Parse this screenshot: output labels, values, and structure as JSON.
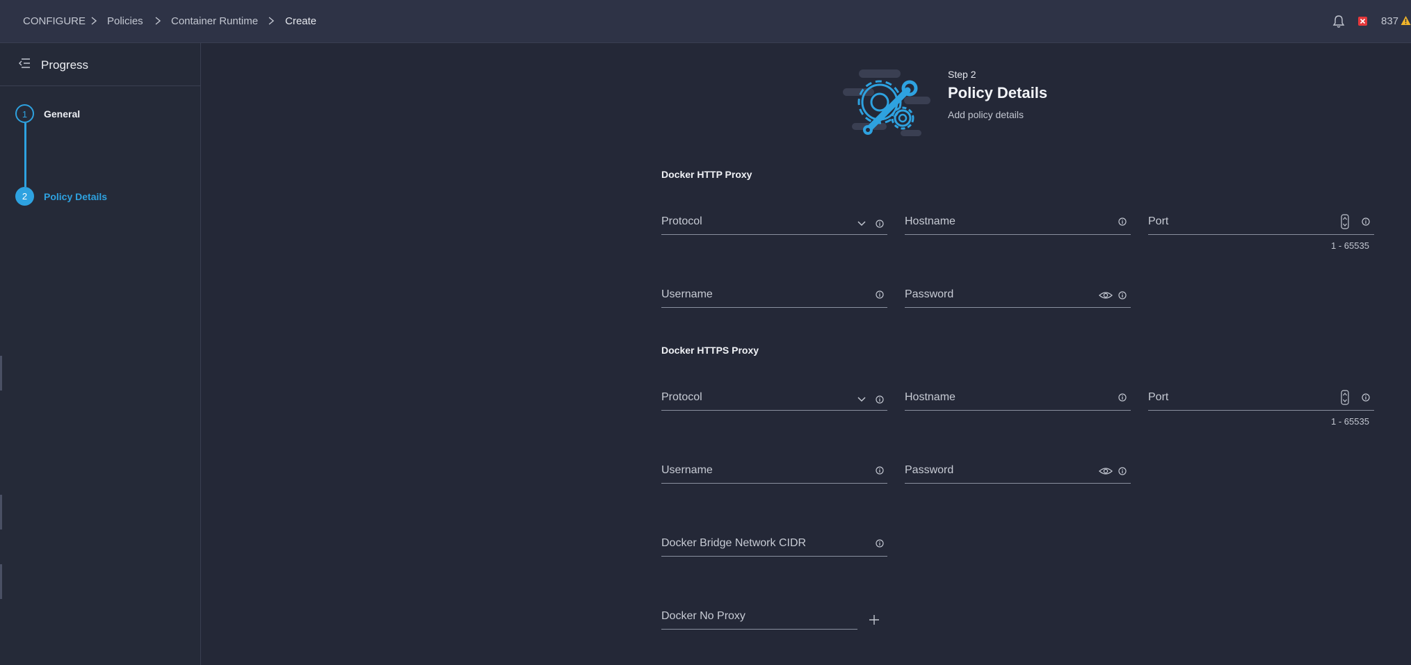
{
  "breadcrumb": {
    "items": [
      "CONFIGURE",
      "Policies",
      "Container Runtime"
    ],
    "current": "Create"
  },
  "topbar": {
    "alert_count": "837",
    "icons": [
      "bell-icon",
      "error-badge-icon",
      "warning-icon"
    ],
    "error_color": "#e5383b",
    "warning_color": "#f0b429"
  },
  "sidebar": {
    "title": "Progress",
    "steps": [
      {
        "number": "1",
        "label": "General",
        "state": "done"
      },
      {
        "number": "2",
        "label": "Policy Details",
        "state": "active"
      }
    ],
    "accent": "#2ea2e0"
  },
  "header": {
    "step": "Step 2",
    "title": "Policy Details",
    "subtitle": "Add policy details"
  },
  "http_proxy": {
    "title": "Docker HTTP Proxy",
    "protocol_label": "Protocol",
    "hostname_label": "Hostname",
    "port_label": "Port",
    "port_hint": "1 - 65535",
    "username_label": "Username",
    "password_label": "Password"
  },
  "https_proxy": {
    "title": "Docker HTTPS Proxy",
    "protocol_label": "Protocol",
    "hostname_label": "Hostname",
    "port_label": "Port",
    "port_hint": "1 - 65535",
    "username_label": "Username",
    "password_label": "Password"
  },
  "bridge": {
    "label": "Docker Bridge Network CIDR"
  },
  "no_proxy": {
    "label": "Docker No Proxy"
  }
}
